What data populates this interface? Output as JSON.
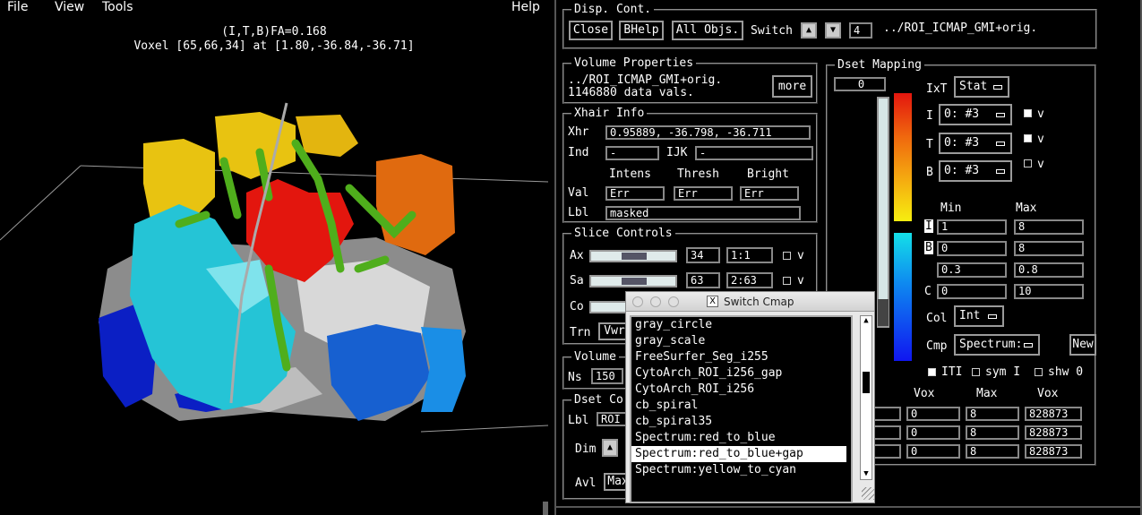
{
  "viewer": {
    "menu": {
      "file": "File",
      "view": "View",
      "tools": "Tools",
      "help": "Help"
    },
    "info_line1": "(I,T,B)FA=0.168",
    "info_line2": "Voxel [65,66,34] at [1.80,-36.84,-36.71]"
  },
  "disp": {
    "legend": "Disp. Cont.",
    "close": "Close",
    "bhelp": "BHelp",
    "allobjs": "All Objs.",
    "switch_label": "Switch",
    "switch_value": "4",
    "dset_name": "../ROI_ICMAP_GMI+orig."
  },
  "volume_props": {
    "legend": "Volume Properties",
    "line1": "../ROI_ICMAP_GMI+orig.",
    "line2": "1146880 data vals.",
    "more": "more"
  },
  "xhair": {
    "legend": "Xhair Info",
    "xhr_label": "Xhr",
    "xhr_value": "0.95889, -36.798, -36.711",
    "ind_label": "Ind",
    "ind_value": "-",
    "ijk_label": "IJK",
    "ijk_value": "-",
    "col_intens": "Intens",
    "col_thresh": "Thresh",
    "col_bright": "Bright",
    "val_label": "Val",
    "val1": "Err",
    "val2": "Err",
    "val3": "Err",
    "lbl_label": "Lbl",
    "lbl_value": "masked"
  },
  "slice": {
    "legend": "Slice Controls",
    "ax_label": "Ax",
    "ax_value": "34",
    "ax_ratio": "1:1",
    "sa_label": "Sa",
    "sa_value": "63",
    "sa_ratio": "2:63",
    "co_label": "Co",
    "trn_label": "Trn",
    "trn_value": "Vwr",
    "v": "v"
  },
  "volume": {
    "legend": "Volume",
    "ns_label": "Ns",
    "ns_value": "150"
  },
  "dsetc": {
    "legend": "Dset Co",
    "lbl_label": "Lbl",
    "lbl_value": "ROI_",
    "dim_label": "Dim",
    "avl_label": "Avl",
    "avl_value": "Max"
  },
  "mapping": {
    "legend": "Dset Mapping",
    "top_value": "0",
    "ixt_label": "IxT",
    "ixt_value": "Stat",
    "i_label": "I",
    "i_value": "0: #3",
    "t_label": "T",
    "t_value": "0: #3",
    "b_label": "B",
    "b_value": "0: #3",
    "v": "v",
    "min_header": "Min",
    "max_header": "Max",
    "row_i_label": "I",
    "row_i_min": "1",
    "row_i_max": "8",
    "row_b_label": "B",
    "row_b_min": "0",
    "row_b_max": "8",
    "row3_min": "0.3",
    "row3_max": "0.8",
    "row_c_label": "C",
    "row_c_min": "0",
    "row_c_max": "10",
    "col_label": "Col",
    "col_value": "Int",
    "cmp_label": "Cmp",
    "cmp_value": "Spectrum:",
    "new": "New",
    "iti": "ITI",
    "sym": "sym I",
    "shw": "shw 0",
    "table_headers": [
      "Vox",
      "Max",
      "Vox"
    ],
    "table_rows": [
      [
        "0",
        "8",
        "828873"
      ],
      [
        "0",
        "8",
        "828873"
      ],
      [
        "0",
        "8",
        "828873"
      ]
    ]
  },
  "popup": {
    "title": "Switch Cmap",
    "items": [
      "gray_circle",
      "gray_scale",
      "FreeSurfer_Seg_i255",
      "CytoArch_ROI_i256_gap",
      "CytoArch_ROI_i256",
      "cb_spiral",
      "cb_spiral35",
      "Spectrum:red_to_blue",
      "Spectrum:red_to_blue+gap",
      "Spectrum:yellow_to_cyan"
    ],
    "selected_index": 8
  },
  "colors": {
    "cyan": "#25c4d6",
    "red": "#e3160e",
    "yellow": "#e8c311",
    "orange": "#e06a0f",
    "green": "#4fae1c",
    "blue": "#1760d0",
    "navy": "#0b1fc4"
  }
}
